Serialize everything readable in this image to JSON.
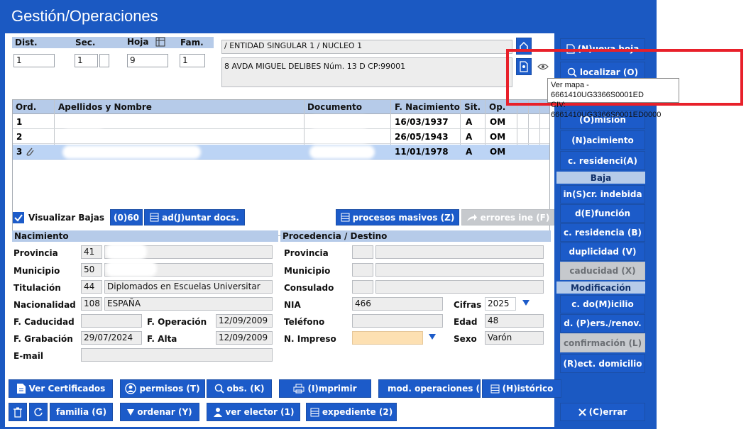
{
  "title": "Gestión/Operaciones",
  "top": {
    "dist_label": "Dist.",
    "sec_label": "Sec.",
    "hoja_label": "Hoja",
    "fam_label": "Fam.",
    "dist": "1",
    "sec": "1",
    "sec2": "",
    "hoja": "9",
    "fam": "1",
    "entidad": "/ ENTIDAD SINGULAR 1 / NUCLEO 1",
    "direccion": "8 AVDA MIGUEL DELIBES Núm. 13 D CP:99001"
  },
  "tooltip": {
    "line1": "Ver mapa - 6661410UG3366S0001ED",
    "line2": "CIV: 6661410UG3366S0001ED0000"
  },
  "table": {
    "headers": [
      "Ord.",
      "Apellidos y Nombre",
      "Documento",
      "F. Nacimiento",
      "Sit.",
      "Op."
    ],
    "rows": [
      {
        "ord": "1",
        "nombre": "",
        "doc": "",
        "fnac": "16/03/1937",
        "sit": "A",
        "op": "OM"
      },
      {
        "ord": "2",
        "nombre": "",
        "doc": "",
        "fnac": "26/05/1943",
        "sit": "A",
        "op": "OM"
      },
      {
        "ord": "3",
        "nombre": "",
        "doc": "",
        "fnac": "11/01/1978",
        "sit": "A",
        "op": "OM"
      }
    ]
  },
  "mid": {
    "visualizar_bajas": "Visualizar Bajas",
    "count": "(0)60",
    "adjuntar": "ad(J)untar docs.",
    "procesos": "procesos masivos (Z)",
    "errores": "errores ine (F)"
  },
  "nacimiento": {
    "header": "Nacimiento",
    "provincia_label": "Provincia",
    "provincia_code": "41",
    "municipio_label": "Municipio",
    "municipio_code": "50",
    "titulacion_label": "Titulación",
    "titulacion_code": "44",
    "titulacion": "Diplomados en Escuelas Universitar",
    "nacionalidad_label": "Nacionalidad",
    "nacionalidad_code": "108",
    "nacionalidad": "ESPAÑA",
    "fcaducidad_label": "F. Caducidad",
    "foperacion_label": "F. Operación",
    "foperacion": "12/09/2009",
    "fgrabacion_label": "F. Grabación",
    "fgrabacion": "29/07/2024",
    "falta_label": "F. Alta",
    "falta": "12/09/2009",
    "email_label": "E-mail"
  },
  "procedencia": {
    "header": "Procedencia / Destino",
    "provincia_label": "Provincia",
    "municipio_label": "Municipio",
    "consulado_label": "Consulado",
    "nia_label": "NIA",
    "nia": "466",
    "cifras_label": "Cifras",
    "cifras": "2025",
    "telefono_label": "Teléfono",
    "edad_label": "Edad",
    "edad": "48",
    "nimpreso_label": "N. Impreso",
    "sexo_label": "Sexo",
    "sexo": "Varón"
  },
  "side": {
    "nueva_hoja": "(N)ueva hoja",
    "localizar": "localizar (O)",
    "omision": "(O)misión",
    "nacimiento": "(N)acimiento",
    "residencia_a": "c. residenci(A)",
    "baja_header": "Baja",
    "indebida": "in(S)cr. indebida",
    "defuncion": "d(E)función",
    "residencia_b": "c. residencia (B)",
    "duplicidad": "duplicidad (V)",
    "caducidad": "caducidad (X)",
    "mod_header": "Modificación",
    "domicilio": "c. do(M)icilio",
    "pers": "d. (P)ers./renov.",
    "confirmacion": "confirmación (L)",
    "rect": "(R)ect. domicilio"
  },
  "bottom": {
    "certificados": "Ver Certificados",
    "permisos": "permisos (T)",
    "obs": "obs. (K)",
    "imprimir": "(I)mprimir",
    "mod_operaciones": "mod. operaciones (",
    "historico": "(H)istórico",
    "familia": "familia (G)",
    "ordenar": "ordenar (Y)",
    "elector": "ver elector (1)",
    "expediente": "expediente (2)",
    "cerrar": "(C)errar"
  },
  "colors": {
    "frame": "#1b59c2",
    "header": "#b6cbe9",
    "selected_row": "#bcd4f5",
    "highlight_box": "#e8202a",
    "impreso_field": "#fde0b2"
  }
}
